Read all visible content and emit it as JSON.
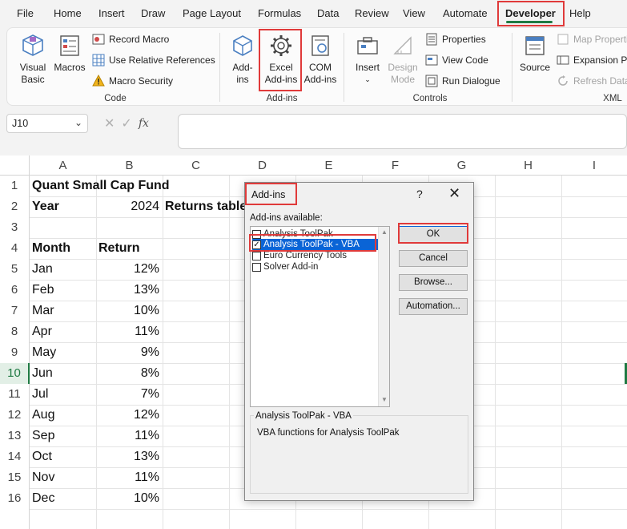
{
  "menu": {
    "tabs": [
      "File",
      "Home",
      "Insert",
      "Draw",
      "Page Layout",
      "Formulas",
      "Data",
      "Review",
      "View",
      "Automate",
      "Developer",
      "Help"
    ],
    "active": "Developer"
  },
  "ribbon": {
    "code": {
      "visual_basic": "Visual Basic",
      "macros": "Macros",
      "record_macro": "Record Macro",
      "relative_refs": "Use Relative References",
      "macro_security": "Macro Security",
      "label": "Code"
    },
    "addins": {
      "addins": "Add-ins",
      "excel_addins": "Excel Add-ins",
      "com_addins": "COM Add-ins",
      "label": "Add-ins"
    },
    "controls": {
      "insert": "Insert",
      "design_mode": "Design Mode",
      "properties": "Properties",
      "view_code": "View Code",
      "run_dialogue": "Run Dialogue",
      "label": "Controls"
    },
    "xml": {
      "source": "Source",
      "map_properties": "Map Properties",
      "expansion_packs": "Expansion Packs",
      "refresh_data": "Refresh Data",
      "label": "XML"
    }
  },
  "formula_bar": {
    "name_box": "J10",
    "fx": "fx",
    "formula": ""
  },
  "sheet": {
    "columns": [
      "A",
      "B",
      "C",
      "D",
      "E",
      "F",
      "G",
      "H",
      "I"
    ],
    "rows": [
      "1",
      "2",
      "3",
      "4",
      "5",
      "6",
      "7",
      "8",
      "9",
      "10",
      "11",
      "12",
      "13",
      "14",
      "15",
      "16"
    ],
    "selected_row": "10",
    "title": "Quant Small Cap Fund",
    "year_label": "Year",
    "year_value": "2024",
    "returns_table": "Returns table",
    "month_header": "Month",
    "return_header": "Return",
    "months": [
      "Jan",
      "Feb",
      "Mar",
      "Apr",
      "May",
      "Jun",
      "Jul",
      "Aug",
      "Sep",
      "Oct",
      "Nov",
      "Dec"
    ],
    "returns": [
      "12%",
      "13%",
      "10%",
      "11%",
      "9%",
      "8%",
      "7%",
      "12%",
      "11%",
      "13%",
      "11%",
      "10%"
    ]
  },
  "dialog": {
    "title": "Add-ins",
    "help": "?",
    "close": "✕",
    "available_label": "Add-ins available:",
    "items": [
      {
        "label": "Analysis ToolPak",
        "checked": false
      },
      {
        "label": "Analysis ToolPak - VBA",
        "checked": true
      },
      {
        "label": "Euro Currency Tools",
        "checked": false
      },
      {
        "label": "Solver Add-in",
        "checked": false
      }
    ],
    "buttons": {
      "ok": "OK",
      "cancel": "Cancel",
      "browse": "Browse...",
      "automation": "Automation..."
    },
    "description_title": "Analysis ToolPak - VBA",
    "description": "VBA functions for Analysis ToolPak"
  },
  "colors": {
    "accent": "#1f7a43",
    "highlight": "#e03a3a",
    "selection": "#0a64d6"
  }
}
